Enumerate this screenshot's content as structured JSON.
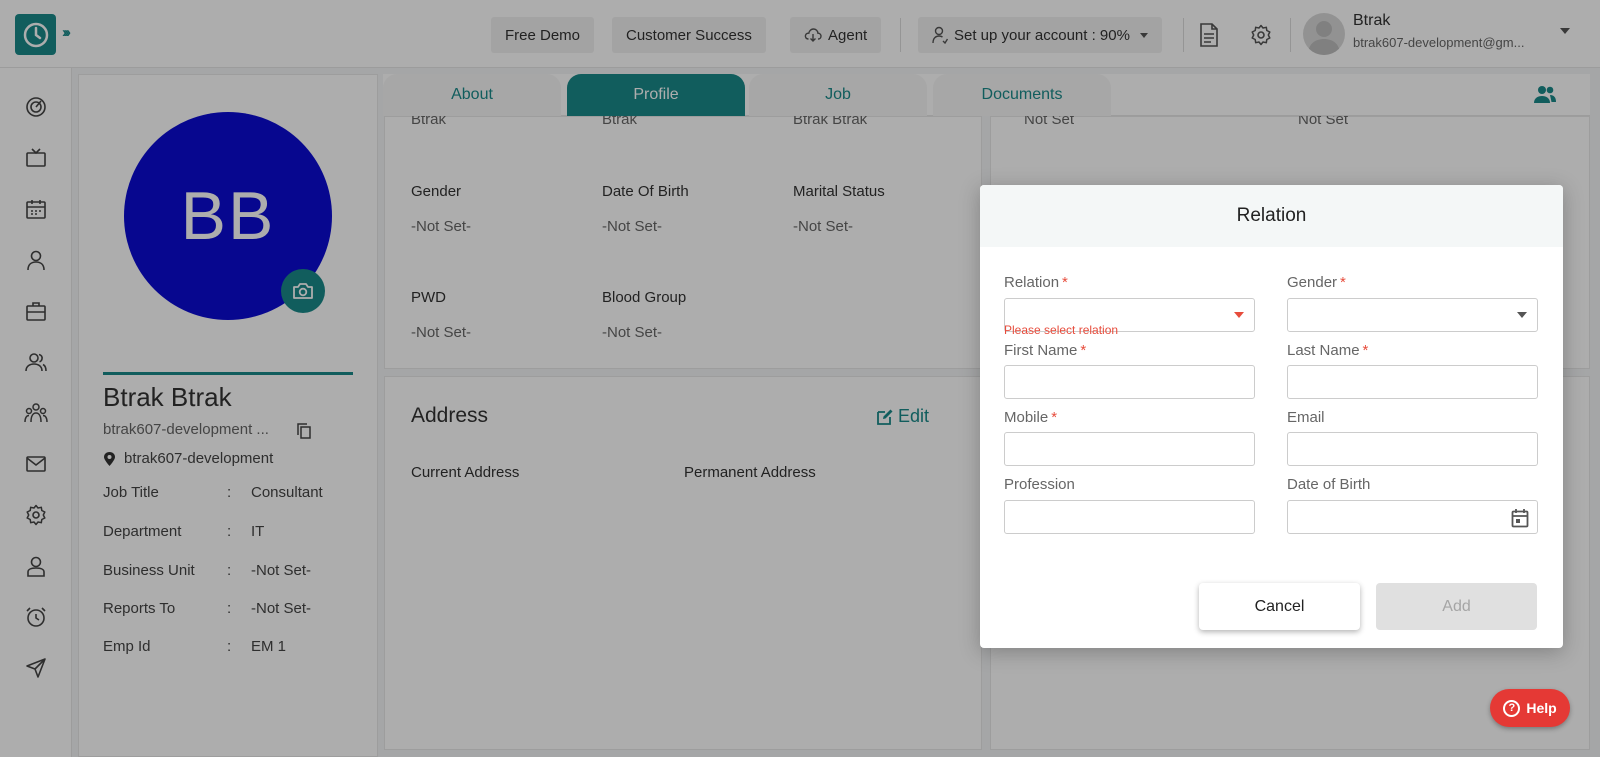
{
  "topbar": {
    "free_demo": "Free Demo",
    "customer_success": "Customer Success",
    "agent": "Agent",
    "setup": "Set up your account : 90%",
    "user_name": "Btrak",
    "user_email": "btrak607-development@gm..."
  },
  "profile": {
    "initials": "BB",
    "name": "Btrak Btrak",
    "email": "btrak607-development ...",
    "location": "btrak607-development",
    "rows": [
      {
        "label": "Job Title",
        "value": "Consultant"
      },
      {
        "label": "Department",
        "value": "IT"
      },
      {
        "label": "Business Unit",
        "value": "-Not Set-"
      },
      {
        "label": "Reports To",
        "value": "-Not Set-"
      },
      {
        "label": "Emp Id",
        "value": "EM 1"
      }
    ],
    "colon": ":"
  },
  "tabs": [
    {
      "label": "About",
      "active": false
    },
    {
      "label": "Profile",
      "active": true
    },
    {
      "label": "Job",
      "active": false
    },
    {
      "label": "Documents",
      "active": false
    }
  ],
  "personal": {
    "cut_values": [
      "Btrak",
      "Btrak",
      "Btrak Btrak",
      "Not Set",
      "Not Set"
    ],
    "gender_label": "Gender",
    "gender_value": "-Not Set-",
    "dob_label": "Date Of Birth",
    "dob_value": "-Not Set-",
    "marital_label": "Marital Status",
    "marital_value": "-Not Set-",
    "pwd_label": "PWD",
    "pwd_value": "-Not Set-",
    "blood_label": "Blood Group",
    "blood_value": "-Not Set-"
  },
  "address": {
    "title": "Address",
    "edit": "Edit",
    "current": "Current Address",
    "permanent": "Permanent Address"
  },
  "modal": {
    "title": "Relation",
    "relation_label": "Relation",
    "relation_error": "Please select relation",
    "gender_label": "Gender",
    "first_name_label": "First Name",
    "last_name_label": "Last Name",
    "mobile_label": "Mobile",
    "email_label": "Email",
    "profession_label": "Profession",
    "dob_label": "Date of Birth",
    "required_mark": "*",
    "cancel": "Cancel",
    "add": "Add"
  },
  "help": "Help",
  "colors": {
    "accent": "#1a8a8a",
    "avatar_bg": "#0b0bd3",
    "error": "#e74c3c",
    "help_bg": "#e53935"
  }
}
